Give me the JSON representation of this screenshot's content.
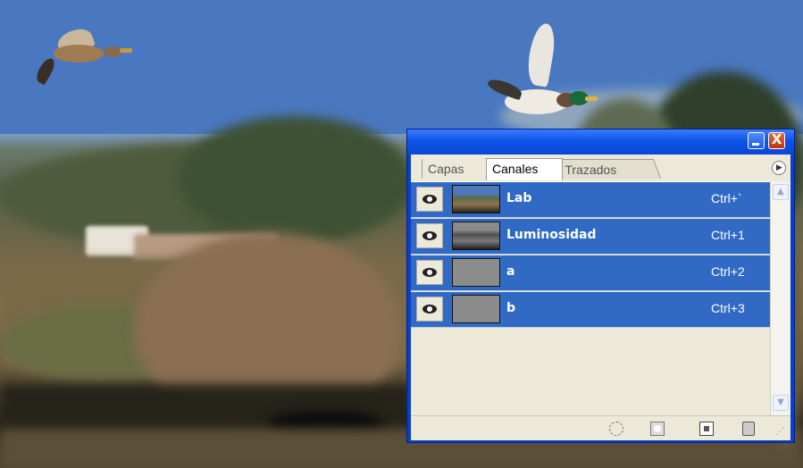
{
  "panel": {
    "tabs": [
      {
        "label": "Capas"
      },
      {
        "label": "Canales"
      },
      {
        "label": "Trazados"
      }
    ],
    "channels": [
      {
        "name": "Lab",
        "shortcut": "Ctrl+`",
        "visible": true,
        "thumb_icon": "color-photo-thumbnail"
      },
      {
        "name": "Luminosidad",
        "shortcut": "Ctrl+1",
        "visible": true,
        "thumb_icon": "grayscale-photo-thumbnail"
      },
      {
        "name": "a",
        "shortcut": "Ctrl+2",
        "visible": true,
        "thumb_icon": "gray-thumbnail"
      },
      {
        "name": "b",
        "shortcut": "Ctrl+3",
        "visible": true,
        "thumb_icon": "gray-thumbnail"
      }
    ],
    "title_buttons": {
      "minimize_icon": "minimize-icon",
      "close_label": "X"
    },
    "footer_icons": [
      "load-selection-icon",
      "save-selection-icon",
      "new-channel-icon",
      "delete-channel-icon"
    ],
    "selection_color": "#316ac5",
    "titlebar_color": "#0a47d6"
  }
}
